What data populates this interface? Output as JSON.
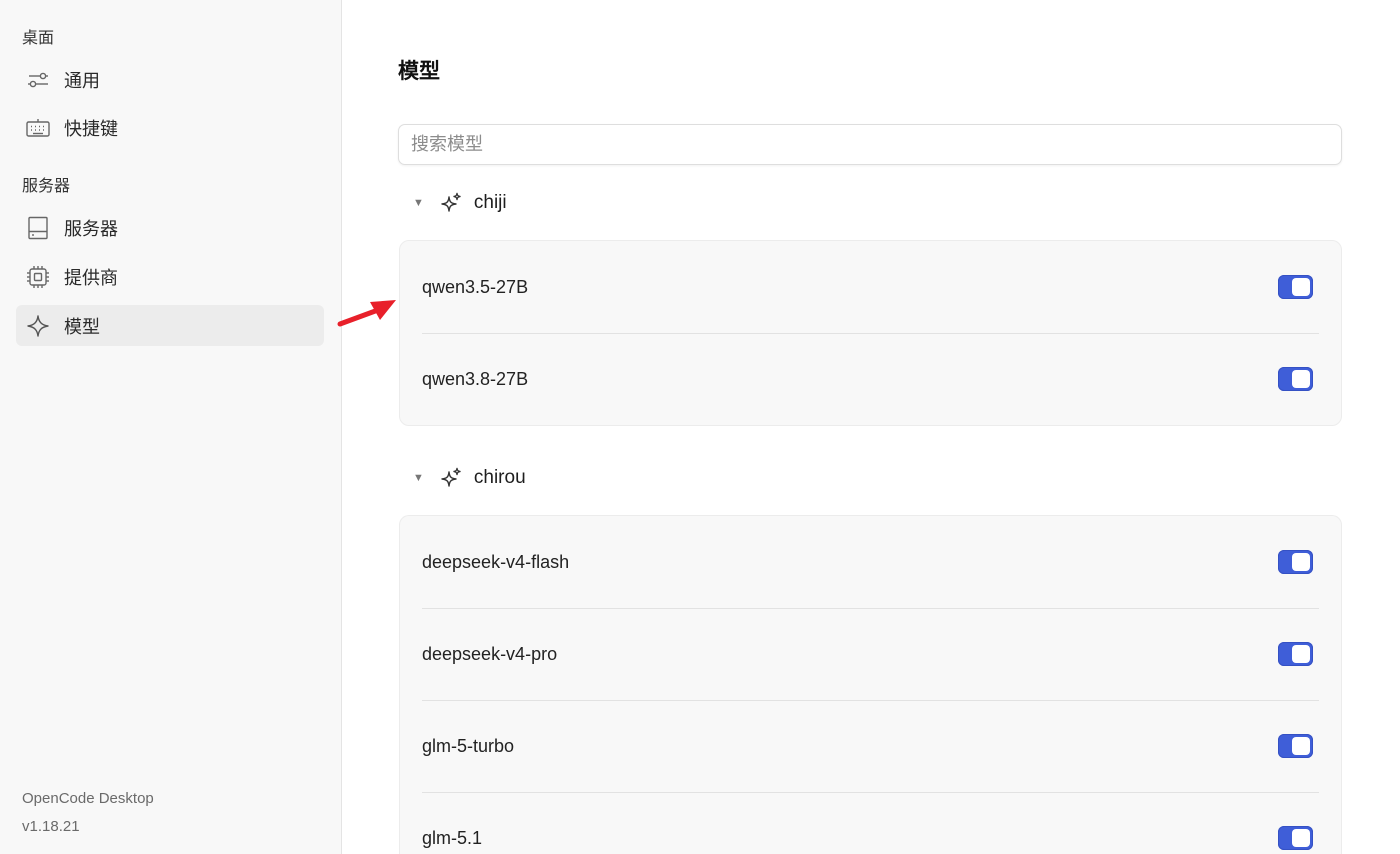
{
  "sidebar": {
    "section_desktop": "桌面",
    "section_server": "服务器",
    "items": [
      {
        "label": "通用",
        "icon": "sliders-icon"
      },
      {
        "label": "快捷键",
        "icon": "keyboard-icon"
      },
      {
        "label": "服务器",
        "icon": "server-icon"
      },
      {
        "label": "提供商",
        "icon": "chip-icon"
      },
      {
        "label": "模型",
        "icon": "sparkle-icon",
        "active": true
      }
    ],
    "footer": {
      "app_name": "OpenCode Desktop",
      "version": "v1.18.21"
    }
  },
  "main": {
    "title": "模型",
    "search": {
      "placeholder": "搜索模型",
      "value": ""
    },
    "groups": [
      {
        "name": "chiji",
        "icon": "sparkles-icon",
        "expanded": true,
        "models": [
          {
            "name": "qwen3.5-27B",
            "enabled": true
          },
          {
            "name": "qwen3.8-27B",
            "enabled": true
          }
        ]
      },
      {
        "name": "chirou",
        "icon": "sparkles-icon",
        "expanded": true,
        "models": [
          {
            "name": "deepseek-v4-flash",
            "enabled": true
          },
          {
            "name": "deepseek-v4-pro",
            "enabled": true
          },
          {
            "name": "glm-5-turbo",
            "enabled": true
          },
          {
            "name": "glm-5.1",
            "enabled": true
          }
        ]
      }
    ]
  },
  "colors": {
    "accent": "#3f5ed8",
    "annotation_arrow": "#e8202a",
    "sidebar_bg": "#f8f8f8",
    "card_bg": "#f8f8f8"
  }
}
